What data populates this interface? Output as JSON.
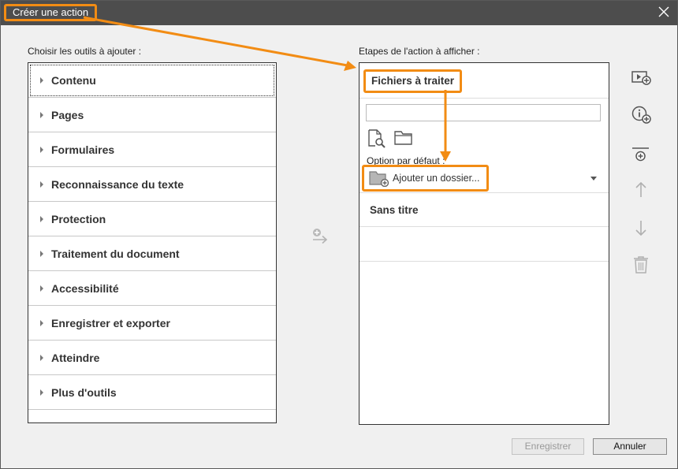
{
  "dialog": {
    "title": "Créer une action",
    "close_icon": "close-icon"
  },
  "tools_panel": {
    "label": "Choisir les outils à ajouter :",
    "items": [
      {
        "label": "Contenu"
      },
      {
        "label": "Pages"
      },
      {
        "label": "Formulaires"
      },
      {
        "label": "Reconnaissance du texte"
      },
      {
        "label": "Protection"
      },
      {
        "label": "Traitement du document"
      },
      {
        "label": "Accessibilité"
      },
      {
        "label": "Enregistrer et exporter"
      },
      {
        "label": "Atteindre"
      },
      {
        "label": "Plus d'outils"
      }
    ]
  },
  "steps_panel": {
    "label": "Etapes de l'action à afficher :",
    "files_title": "Fichiers à traiter",
    "input_value": "",
    "option_label": "Option par défaut :",
    "folder_option": "Ajouter un dossier...",
    "untitled_step": "Sans titre"
  },
  "side_icons": [
    "add-instruction-icon",
    "add-info-icon",
    "add-divider-icon",
    "move-up-icon",
    "move-down-icon",
    "delete-icon"
  ],
  "buttons": {
    "save": "Enregistrer",
    "cancel": "Annuler"
  },
  "colors": {
    "highlight": "#f28c14",
    "titlebar": "#4d4d4d"
  }
}
